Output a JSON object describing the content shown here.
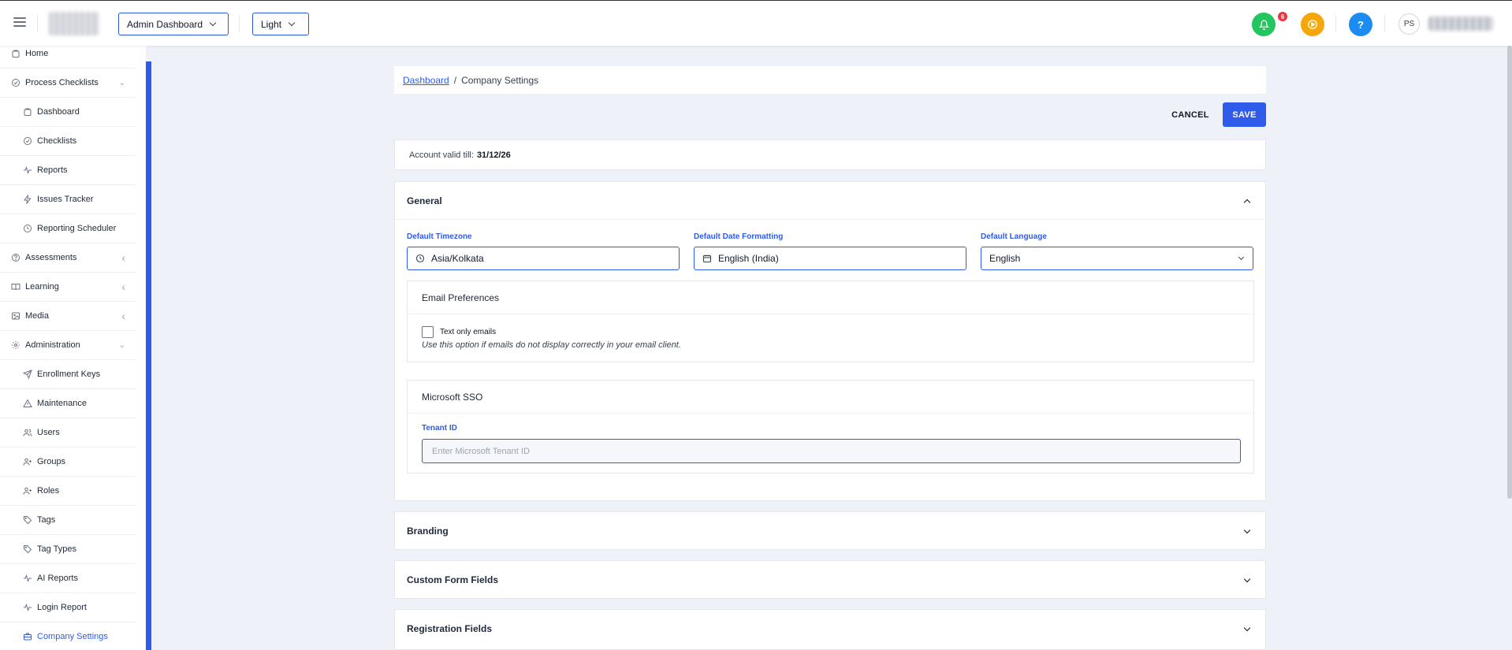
{
  "header": {
    "dashboard_select": "Admin Dashboard",
    "theme_select": "Light",
    "notification_count": "6",
    "help_label": "?",
    "user_initials": "PS"
  },
  "sidebar": {
    "items": [
      {
        "label": "Home",
        "icon": "home-icon",
        "level": "top"
      },
      {
        "label": "Process Checklists",
        "icon": "check-circle-icon",
        "level": "top",
        "arrow": "down"
      },
      {
        "label": "Dashboard",
        "icon": "dashboard-icon",
        "level": "sub"
      },
      {
        "label": "Checklists",
        "icon": "check-circle-icon",
        "level": "sub"
      },
      {
        "label": "Reports",
        "icon": "activity-icon",
        "level": "sub"
      },
      {
        "label": "Issues Tracker",
        "icon": "bolt-icon",
        "level": "sub"
      },
      {
        "label": "Reporting Scheduler",
        "icon": "clock-icon",
        "level": "sub"
      },
      {
        "label": "Assessments",
        "icon": "question-circle-icon",
        "level": "top",
        "arrow": "left"
      },
      {
        "label": "Learning",
        "icon": "book-icon",
        "level": "top",
        "arrow": "left"
      },
      {
        "label": "Media",
        "icon": "image-icon",
        "level": "top",
        "arrow": "left"
      },
      {
        "label": "Administration",
        "icon": "gear-icon",
        "level": "top",
        "arrow": "down"
      },
      {
        "label": "Enrollment Keys",
        "icon": "send-icon",
        "level": "sub"
      },
      {
        "label": "Maintenance",
        "icon": "warning-icon",
        "level": "sub"
      },
      {
        "label": "Users",
        "icon": "users-icon",
        "level": "sub"
      },
      {
        "label": "Groups",
        "icon": "user-plus-icon",
        "level": "sub"
      },
      {
        "label": "Roles",
        "icon": "user-plus-icon",
        "level": "sub"
      },
      {
        "label": "Tags",
        "icon": "tag-icon",
        "level": "sub"
      },
      {
        "label": "Tag Types",
        "icon": "tag-icon",
        "level": "sub"
      },
      {
        "label": "AI Reports",
        "icon": "activity-icon",
        "level": "sub"
      },
      {
        "label": "Login Report",
        "icon": "activity-icon",
        "level": "sub"
      },
      {
        "label": "Company Settings",
        "icon": "briefcase-icon",
        "level": "sub",
        "active": true
      }
    ]
  },
  "breadcrumb": {
    "root": "Dashboard",
    "separator": "/",
    "current": "Company Settings"
  },
  "actions": {
    "cancel": "CANCEL",
    "save": "SAVE"
  },
  "account": {
    "label": "Account valid till:",
    "date": "31/12/26"
  },
  "general": {
    "title": "General",
    "timezone": {
      "label": "Default Timezone",
      "value": "Asia/Kolkata"
    },
    "date_format": {
      "label": "Default Date Formatting",
      "value": "English (India)"
    },
    "language": {
      "label": "Default Language",
      "value": "English"
    },
    "email_prefs": {
      "title": "Email Preferences",
      "checkbox_label": "Text only emails",
      "hint": "Use this option if emails do not display correctly in your email client."
    },
    "sso": {
      "title": "Microsoft SSO",
      "tenant_label": "Tenant ID",
      "tenant_placeholder": "Enter Microsoft Tenant ID"
    }
  },
  "sections": {
    "branding": "Branding",
    "custom_form_fields": "Custom Form Fields",
    "registration_fields": "Registration Fields"
  },
  "colors": {
    "accent": "#2f5bea",
    "notify": "#22c55e",
    "play": "#f5a70a",
    "help": "#1d8cf0",
    "badge": "#ef3340"
  }
}
